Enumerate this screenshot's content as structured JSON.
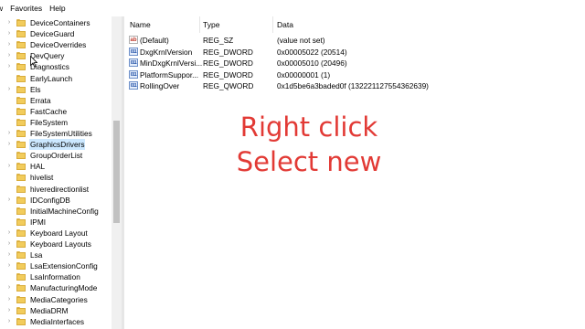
{
  "menu": [
    "w",
    "Favorites",
    "Help"
  ],
  "tree": {
    "items": [
      {
        "label": "DeviceContainers",
        "expandable": true
      },
      {
        "label": "DeviceGuard",
        "expandable": true
      },
      {
        "label": "DeviceOverrides",
        "expandable": true
      },
      {
        "label": "DevQuery",
        "expandable": true
      },
      {
        "label": "Diagnostics",
        "expandable": true
      },
      {
        "label": "EarlyLaunch",
        "expandable": false
      },
      {
        "label": "Els",
        "expandable": true
      },
      {
        "label": "Errata",
        "expandable": false
      },
      {
        "label": "FastCache",
        "expandable": false
      },
      {
        "label": "FileSystem",
        "expandable": false
      },
      {
        "label": "FileSystemUtilities",
        "expandable": true
      },
      {
        "label": "GraphicsDrivers",
        "expandable": true,
        "selected": true
      },
      {
        "label": "GroupOrderList",
        "expandable": false
      },
      {
        "label": "HAL",
        "expandable": true
      },
      {
        "label": "hivelist",
        "expandable": false
      },
      {
        "label": "hiveredirectionlist",
        "expandable": false
      },
      {
        "label": "IDConfigDB",
        "expandable": true
      },
      {
        "label": "InitialMachineConfig",
        "expandable": false
      },
      {
        "label": "IPMI",
        "expandable": false
      },
      {
        "label": "Keyboard Layout",
        "expandable": true
      },
      {
        "label": "Keyboard Layouts",
        "expandable": true
      },
      {
        "label": "Lsa",
        "expandable": true
      },
      {
        "label": "LsaExtensionConfig",
        "expandable": true
      },
      {
        "label": "LsaInformation",
        "expandable": false
      },
      {
        "label": "ManufacturingMode",
        "expandable": true
      },
      {
        "label": "MediaCategories",
        "expandable": true
      },
      {
        "label": "MediaDRM",
        "expandable": true
      },
      {
        "label": "MediaInterfaces",
        "expandable": true
      }
    ]
  },
  "list": {
    "columns": [
      "Name",
      "Type",
      "Data"
    ],
    "rows": [
      {
        "icon": "string-value-icon",
        "name": "(Default)",
        "type": "REG_SZ",
        "data": "(value not set)"
      },
      {
        "icon": "binary-value-icon",
        "name": "DxgKrnlVersion",
        "type": "REG_DWORD",
        "data": "0x00005022 (20514)"
      },
      {
        "icon": "binary-value-icon",
        "name": "MinDxgKrnlVersi...",
        "type": "REG_DWORD",
        "data": "0x00005010 (20496)"
      },
      {
        "icon": "binary-value-icon",
        "name": "PlatformSuppor...",
        "type": "REG_DWORD",
        "data": "0x00000001 (1)"
      },
      {
        "icon": "binary-value-icon",
        "name": "RollingOver",
        "type": "REG_QWORD",
        "data": "0x1d5be6a3baded0f (132221127554362639)"
      }
    ]
  },
  "overlay": {
    "line1": "Right click",
    "line2": "Select new",
    "color": "#e23a35"
  },
  "colors": {
    "selection": "#cce8ff",
    "folder": "#f2cc5c"
  }
}
